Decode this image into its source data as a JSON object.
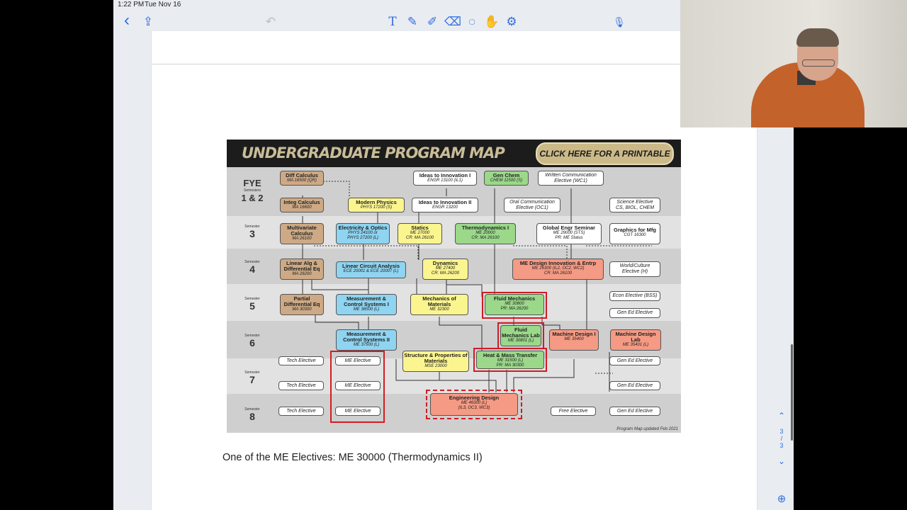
{
  "status": {
    "time": "1:22 PM",
    "date": "Tue Nov 16"
  },
  "toolbar": {
    "back": "‹",
    "share": "⇪",
    "undo": "↶",
    "text": "T",
    "pen": "✎",
    "highlighter": "✐",
    "eraser": "⌫",
    "lasso": "◌",
    "hand": "✋",
    "tools": "⚙",
    "mic": "🎙"
  },
  "map": {
    "title": "UNDERGRADUATE PROGRAM MAP",
    "print_button": "CLICK HERE FOR A PRINTABLE PDF",
    "updated": "Program Map updated Feb 2021",
    "sem_word": "Semester",
    "fye": "FYE",
    "fye_sem": "Semesters",
    "fye_num": "1 & 2",
    "semesters": [
      "3",
      "4",
      "5",
      "6",
      "7",
      "8"
    ],
    "courses": {
      "diffcalc": {
        "t": "Diff Calculus",
        "c": "MA 16500 (QR)"
      },
      "integcalc": {
        "t": "Integ Calculus",
        "c": "MA 16600"
      },
      "modphys": {
        "t": "Modern Physics",
        "c": "PHYS 17200 (S)"
      },
      "ideas1": {
        "t": "Ideas to Innovation I",
        "c": "ENGR 13100 (IL1)"
      },
      "ideas2": {
        "t": "Ideas to Innovation II",
        "c": "ENGR 13200"
      },
      "genchem": {
        "t": "Gen Chem",
        "c": "CHEM 11500 (S)"
      },
      "writcomm": {
        "t": "Written Communication",
        "c": "Elective (WC1)"
      },
      "oralcomm": {
        "t": "Oral Communication",
        "c": "Elective (OC1)"
      },
      "scielec": {
        "t": "Science Elective",
        "c": "CS, BIOL, CHEM"
      },
      "multicalc": {
        "t": "Multivariate Calculus",
        "c": "MA 26100"
      },
      "elecoptics": {
        "t": "Electricity & Optics",
        "c": "PHYS 24100 or",
        "c2": "PHYS 27200 (L)"
      },
      "statics": {
        "t": "Statics",
        "c": "ME 27000",
        "cr": "CR: MA 26100"
      },
      "thermo": {
        "t": "Thermodynamics I",
        "c": "ME 20000",
        "cr": "CR: MA 26100"
      },
      "globalengr": {
        "t": "Global Engr Seminar",
        "c": "ME 29000 (STS)",
        "cr": "PR: ME Status"
      },
      "graphics": {
        "t": "Graphics for Mfg",
        "c": "CGT 16300"
      },
      "linalg": {
        "t": "Linear Alg & Differential Eq",
        "c": "MA 26200"
      },
      "lincirc": {
        "t": "Linear Circuit Analysis",
        "c": "ECE 20001 & ECE 20007 (L)"
      },
      "dynamics": {
        "t": "Dynamics",
        "c": "ME 27400",
        "cr": "CR: MA 26200"
      },
      "medesign": {
        "t": "ME Design Innovation & Entrp",
        "c": "ME 26300 (IL2, OC2, WC2)",
        "cr": "CR: MA 26100"
      },
      "worldcult": {
        "t": "World/Culture",
        "c": "Elective (H)"
      },
      "pde": {
        "t": "Partial Differential Eq",
        "c": "MA 30300"
      },
      "mcs1": {
        "t": "Measurement & Control Systems I",
        "c": "ME 36500 (L)"
      },
      "mechmat": {
        "t": "Mechanics of Materials",
        "c": "ME 32300"
      },
      "fluids": {
        "t": "Fluid Mechanics",
        "c": "ME 30800",
        "cr": "PR: MA 26200"
      },
      "econ": {
        "t": "Econ Elective (BSS)"
      },
      "gened1": {
        "t": "Gen Ed Elective"
      },
      "mcs2": {
        "t": "Measurement & Control Systems II",
        "c": "ME 37500 (L)"
      },
      "fluidslab": {
        "t": "Fluid Mechanics Lab",
        "c": "ME 30801 (L)"
      },
      "machdes1": {
        "t": "Machine Design I",
        "c": "ME 35400"
      },
      "machdeslab": {
        "t": "Machine Design Lab",
        "c": "ME 35401 (L)"
      },
      "structprop": {
        "t": "Structure & Properties of Materials",
        "c": "MSE 23000"
      },
      "heatmass": {
        "t": "Heat & Mass Transfer",
        "c": "ME 31500 (L)",
        "cr": "PR: MA 30300"
      },
      "tech6": {
        "t": "Tech Elective"
      },
      "mee6": {
        "t": "ME Elective"
      },
      "gened6": {
        "t": "Gen Ed Elective"
      },
      "tech7": {
        "t": "Tech Elective"
      },
      "mee7": {
        "t": "ME Elective"
      },
      "gened7": {
        "t": "Gen Ed Elective"
      },
      "engdesign": {
        "t": "Engineering Design",
        "c": "ME 46300 (L)",
        "c2": "(IL3, OC3, WC3)"
      },
      "tech8": {
        "t": "Tech Elective"
      },
      "mee8": {
        "t": "ME Elective"
      },
      "free8": {
        "t": "Free Elective"
      },
      "gened8": {
        "t": "Gen Ed Elective"
      }
    }
  },
  "caption": "One of the ME Electives:  ME 30000 (Thermodynamics II)",
  "pager": {
    "up": "⌃",
    "current": "3",
    "sep": "/",
    "total": "3",
    "down": "⌄",
    "zoom": "⊕"
  }
}
